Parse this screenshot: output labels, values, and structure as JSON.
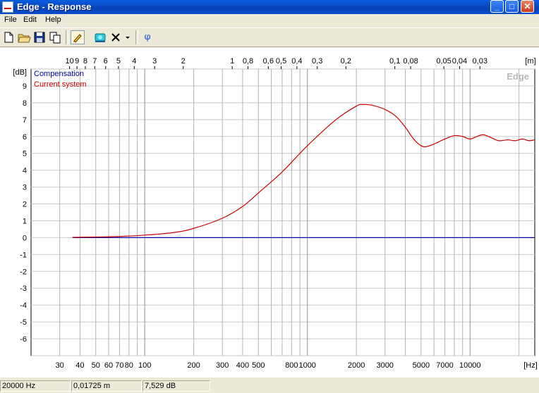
{
  "window": {
    "title": "Edge - Response",
    "min_symbol": "_",
    "max_symbol": "□",
    "close_symbol": "✕"
  },
  "menu": [
    "File",
    "Edit",
    "Help"
  ],
  "toolbar": {
    "phi_label": "φ"
  },
  "chart_data": {
    "type": "line",
    "watermark": "Edge",
    "x_scale": "log",
    "xlim": [
      20,
      25000
    ],
    "ylim": [
      -7,
      10
    ],
    "y_unit": "[dB]",
    "x_unit": "[Hz]",
    "top_unit": "[m]",
    "yticks": [
      9,
      8,
      7,
      6,
      5,
      4,
      3,
      2,
      1,
      0,
      -1,
      -2,
      -3,
      -4,
      -5,
      -6
    ],
    "x_tick_labels": [
      {
        "v": 30,
        "t": "30"
      },
      {
        "v": 40,
        "t": "40"
      },
      {
        "v": 50,
        "t": "50"
      },
      {
        "v": 60,
        "t": "60"
      },
      {
        "v": 70,
        "t": "70"
      },
      {
        "v": 80,
        "t": "80"
      },
      {
        "v": 100,
        "t": "100"
      },
      {
        "v": 200,
        "t": "200"
      },
      {
        "v": 300,
        "t": "300"
      },
      {
        "v": 400,
        "t": "400"
      },
      {
        "v": 500,
        "t": "500"
      },
      {
        "v": 800,
        "t": "800"
      },
      {
        "v": 1000,
        "t": "1000"
      },
      {
        "v": 2000,
        "t": "2000"
      },
      {
        "v": 3000,
        "t": "3000"
      },
      {
        "v": 5000,
        "t": "5000"
      },
      {
        "v": 7000,
        "t": "7000"
      },
      {
        "v": 10000,
        "t": "10000"
      }
    ],
    "x_gridlines": [
      30,
      40,
      50,
      60,
      70,
      80,
      90,
      100,
      200,
      300,
      400,
      500,
      600,
      700,
      800,
      900,
      1000,
      2000,
      3000,
      4000,
      5000,
      6000,
      7000,
      8000,
      9000,
      10000,
      20000
    ],
    "top_tick_labels": [
      {
        "m": 10,
        "t": "10"
      },
      {
        "m": 9,
        "t": "9"
      },
      {
        "m": 8,
        "t": "8"
      },
      {
        "m": 7,
        "t": "7"
      },
      {
        "m": 6,
        "t": "6"
      },
      {
        "m": 5,
        "t": "5"
      },
      {
        "m": 4,
        "t": "4"
      },
      {
        "m": 3,
        "t": "3"
      },
      {
        "m": 2,
        "t": "2"
      },
      {
        "m": 1,
        "t": "1"
      },
      {
        "m": 0.8,
        "t": "0,8"
      },
      {
        "m": 0.6,
        "t": "0,6"
      },
      {
        "m": 0.5,
        "t": "0,5"
      },
      {
        "m": 0.4,
        "t": "0,4"
      },
      {
        "m": 0.3,
        "t": "0,3"
      },
      {
        "m": 0.2,
        "t": "0,2"
      },
      {
        "m": 0.1,
        "t": "0,1"
      },
      {
        "m": 0.08,
        "t": "0,08"
      },
      {
        "m": 0.05,
        "t": "0,05"
      },
      {
        "m": 0.04,
        "t": "0,04"
      },
      {
        "m": 0.03,
        "t": "0,03"
      }
    ],
    "series": [
      {
        "name": "Compensation",
        "color": "#0000a0",
        "points": [
          [
            36,
            0
          ],
          [
            25000,
            0
          ]
        ]
      },
      {
        "name": "Current system",
        "color": "#cc0000",
        "points": [
          [
            36,
            0.02
          ],
          [
            50,
            0.04
          ],
          [
            70,
            0.07
          ],
          [
            100,
            0.15
          ],
          [
            150,
            0.3
          ],
          [
            200,
            0.55
          ],
          [
            300,
            1.15
          ],
          [
            400,
            1.85
          ],
          [
            500,
            2.65
          ],
          [
            700,
            3.9
          ],
          [
            1000,
            5.45
          ],
          [
            1500,
            7.0
          ],
          [
            2000,
            7.8
          ],
          [
            2200,
            7.9
          ],
          [
            2500,
            7.85
          ],
          [
            3000,
            7.6
          ],
          [
            3500,
            7.2
          ],
          [
            4000,
            6.55
          ],
          [
            4500,
            5.85
          ],
          [
            5000,
            5.45
          ],
          [
            5400,
            5.4
          ],
          [
            6000,
            5.55
          ],
          [
            7000,
            5.85
          ],
          [
            8000,
            6.05
          ],
          [
            9000,
            6.0
          ],
          [
            10000,
            5.85
          ],
          [
            11000,
            6.0
          ],
          [
            12000,
            6.1
          ],
          [
            13000,
            6.0
          ],
          [
            15000,
            5.75
          ],
          [
            17000,
            5.8
          ],
          [
            19000,
            5.75
          ],
          [
            21000,
            5.85
          ],
          [
            23000,
            5.75
          ],
          [
            25000,
            5.8
          ]
        ]
      }
    ]
  },
  "status": {
    "frequency": "20000 Hz",
    "distance": "0,01725 m",
    "level": "7,529 dB"
  }
}
